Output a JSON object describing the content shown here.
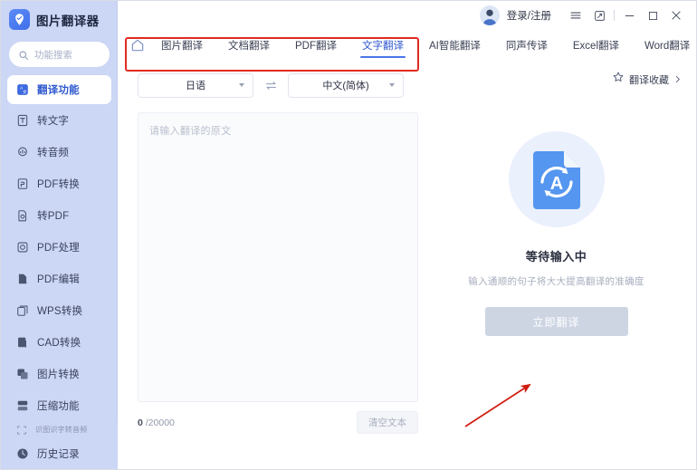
{
  "app": {
    "brand_title": "图片翻译器",
    "logo_icon": "location-pin-icon"
  },
  "sidebar": {
    "search": {
      "placeholder": "功能搜索",
      "icon": "search-icon"
    },
    "items": [
      {
        "label": "翻译功能",
        "icon": "translate-icon",
        "active": true
      },
      {
        "label": "转文字",
        "icon": "text-convert-icon",
        "active": false
      },
      {
        "label": "转音频",
        "icon": "audio-convert-icon",
        "active": false
      },
      {
        "label": "PDF转换",
        "icon": "pdf-convert-icon",
        "active": false
      },
      {
        "label": "转PDF",
        "icon": "to-pdf-icon",
        "active": false
      },
      {
        "label": "PDF处理",
        "icon": "pdf-process-icon",
        "active": false
      },
      {
        "label": "PDF编辑",
        "icon": "pdf-edit-icon",
        "active": false
      },
      {
        "label": "WPS转换",
        "icon": "wps-convert-icon",
        "active": false
      },
      {
        "label": "CAD转换",
        "icon": "cad-convert-icon",
        "active": false
      },
      {
        "label": "图片转换",
        "icon": "image-convert-icon",
        "active": false
      },
      {
        "label": "压缩功能",
        "icon": "compress-icon",
        "active": false
      }
    ],
    "footer_items": [
      {
        "label": "识图识字转音频",
        "icon": "ocr-icon",
        "cut": true
      },
      {
        "label": "历史记录",
        "icon": "history-clock-icon",
        "cut": false
      }
    ]
  },
  "titlebar": {
    "avatar": "user-avatar",
    "login_label": "登录/注册",
    "menu_icon": "hamburger-menu-icon",
    "expand_icon": "expand-window-icon",
    "minimize_icon": "minimize-icon",
    "maximize_icon": "maximize-icon",
    "close_icon": "close-icon"
  },
  "tabs": {
    "home_icon": "home-icon",
    "items": [
      {
        "label": "图片翻译",
        "active": false
      },
      {
        "label": "文档翻译",
        "active": false
      },
      {
        "label": "PDF翻译",
        "active": false
      },
      {
        "label": "文字翻译",
        "active": true
      },
      {
        "label": "AI智能翻译",
        "active": false
      },
      {
        "label": "同声传译",
        "active": false
      },
      {
        "label": "Excel翻译",
        "active": false
      },
      {
        "label": "Word翻译",
        "active": false
      }
    ],
    "more_icon": "chevron-down-icon"
  },
  "language": {
    "source": "日语",
    "target": "中文(简体)",
    "swap_icon": "swap-arrows-icon",
    "caret_icon": "chevron-down-icon"
  },
  "editor": {
    "placeholder": "请输入翻译的原文",
    "count_current": "0",
    "count_max": "/20000",
    "clear_label": "清空文本"
  },
  "favorites": {
    "label": "翻译收藏",
    "star_icon": "star-icon",
    "chevron_icon": "chevron-right-icon"
  },
  "result": {
    "doc_icon": "document-translate-icon",
    "title": "等待输入中",
    "subtitle": "输入通顺的句子将大大提高翻译的准确度",
    "translate_label": "立即翻译"
  },
  "annotations": {
    "box_color": "#e02b20",
    "arrow_color": "#d01d10"
  },
  "colors": {
    "sidebar_bg": "#ccd6f5",
    "accent": "#2f58cf",
    "tab_underline": "#4a74e8",
    "disabled_button": "#cdd5e3"
  }
}
